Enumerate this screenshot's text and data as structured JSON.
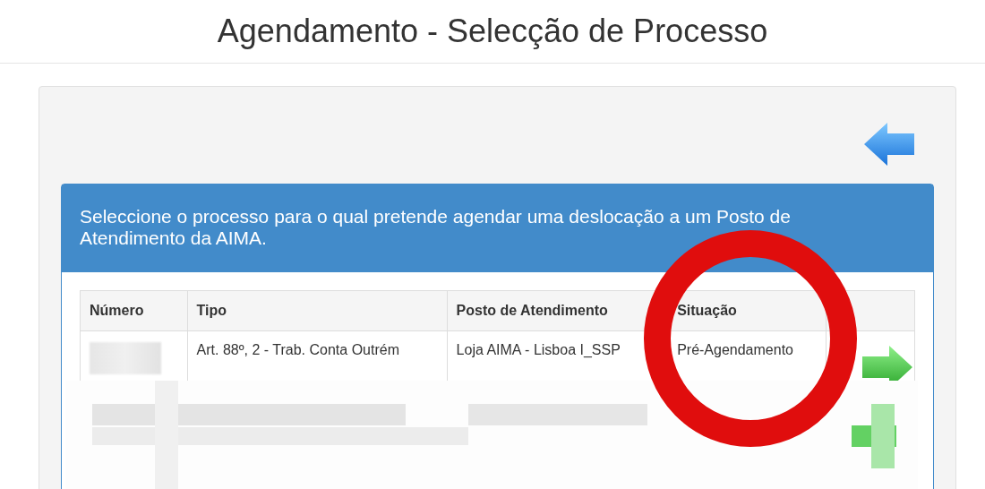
{
  "page_title": "Agendamento - Selecção de Processo",
  "panel": {
    "heading": "Seleccione o processo para o qual pretende agendar uma deslocação a um Posto de Atendimento da AIMA."
  },
  "table": {
    "columns": [
      "Número",
      "Tipo",
      "Posto de Atendimento",
      "Situação"
    ],
    "rows": [
      {
        "numero_redacted": true,
        "tipo": "Art. 88º, 2 - Trab. Conta Outrém",
        "posto": "Loja AIMA - Lisboa I_SSP",
        "situacao": "Pré-Agendamento"
      }
    ]
  },
  "annotation": {
    "kind": "ring"
  }
}
